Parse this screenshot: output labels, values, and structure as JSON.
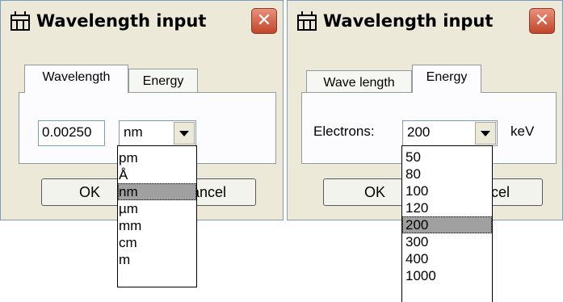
{
  "colors": {
    "window_bg": "#ece9d8",
    "panel_bg": "#fcfcfe",
    "close_red": "#d2583a",
    "selection": "#a0a0a0"
  },
  "left_dialog": {
    "title": "Wavelength input",
    "icon": "wavelength-app-icon",
    "tabs": [
      {
        "label": "Wavelength",
        "active": true
      },
      {
        "label": "Energy",
        "active": false
      }
    ],
    "value_input": "0.00250",
    "unit_selected": "nm",
    "unit_options": [
      "pm",
      "Å",
      "nm",
      "µm",
      "mm",
      "cm",
      "m"
    ],
    "ok_label": "OK",
    "cancel_label": "Cancel"
  },
  "right_dialog": {
    "title": "Wavelength input",
    "icon": "wavelength-app-icon",
    "tabs": [
      {
        "label": "Wave length",
        "active": false
      },
      {
        "label": "Energy",
        "active": true
      }
    ],
    "electrons_label": "Electrons:",
    "energy_selected": "200",
    "energy_unit": "keV",
    "energy_options": [
      "50",
      "80",
      "100",
      "120",
      "200",
      "300",
      "400",
      "1000"
    ],
    "ok_label": "OK",
    "cancel_label": "Cancel"
  }
}
